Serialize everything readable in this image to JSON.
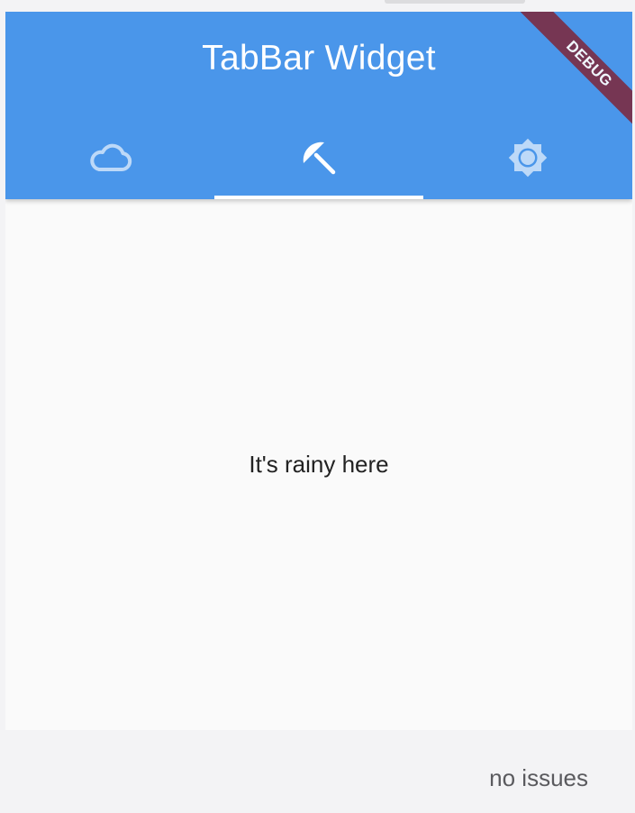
{
  "app": {
    "title": "TabBar Widget",
    "debug_banner": "DEBUG"
  },
  "tabs": [
    {
      "icon": "cloud-outline-icon",
      "selected": false
    },
    {
      "icon": "beach-umbrella-icon",
      "selected": true
    },
    {
      "icon": "brightness-sun-icon",
      "selected": false
    }
  ],
  "content": {
    "text": "It's rainy here"
  },
  "status": {
    "text": "no issues"
  },
  "colors": {
    "appbar": "#4a96ea",
    "indicator": "#ffffff",
    "debug_ribbon": "#7a2e47",
    "unselected_icon": "#bdd9f8",
    "selected_icon": "#ffffff"
  }
}
